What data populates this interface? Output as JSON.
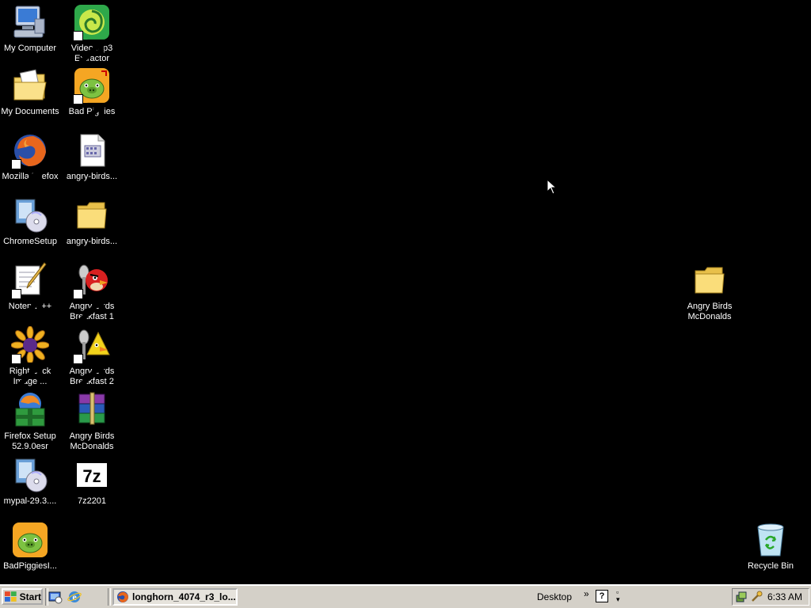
{
  "desktop": {
    "icons": {
      "my_computer": "My Computer",
      "video_mp3": "Video mp3\nExtractor",
      "my_documents": "My Documents",
      "bad_piggies": "Bad Piggies",
      "mozilla_firefox": "Mozilla Firefox",
      "angry_birds_file": "angry-birds...",
      "chrome_setup": "ChromeSetup",
      "angry_birds_folder": "angry-birds...",
      "notepadpp": "Notepad++",
      "ab_breakfast1": "Angry Birds\nBreakfast 1",
      "right_click_image": "Right Click\nImage ...",
      "ab_breakfast2": "Angry Birds\nBreakfast 2",
      "firefox_setup": "Firefox Setup\n52.9.0esr",
      "ab_mcdonalds_archive": "Angry Birds\nMcDonalds",
      "mypal": "mypal-29.3....",
      "sevenzip": "7z2201",
      "badpiggies_installer": "BadPiggiesI...",
      "ab_mcdonalds_folder": "Angry Birds\nMcDonalds",
      "recycle_bin": "Recycle Bin"
    }
  },
  "taskbar": {
    "start_label": "Start",
    "task_button": "longhorn_4074_r3_lo...",
    "desktop_label": "Desktop",
    "chevron": "»",
    "help": "?",
    "clock": "6:33 AM"
  },
  "colors": {
    "desktop_bg": "#000000",
    "taskbar_bg": "#d4d0c8",
    "label": "#ffffff"
  }
}
